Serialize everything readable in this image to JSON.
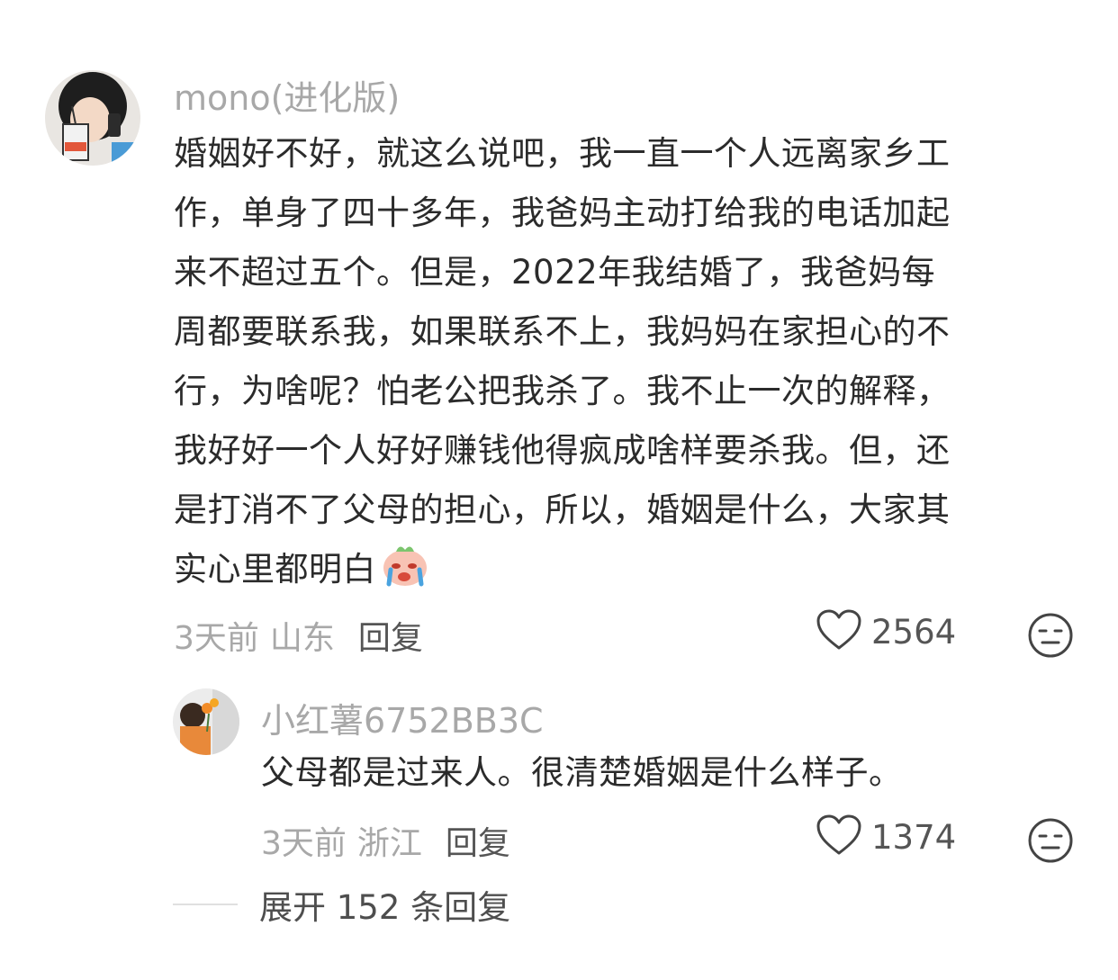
{
  "comments": [
    {
      "username": "mono(进化版)",
      "lines": [
        "婚姻好不好，就这么说吧，我一直一个人远离家乡工",
        "作，单身了四十多年，我爸妈主动打给我的电话加起",
        "来不超过五个。但是，2022年我结婚了，我爸妈每",
        "周都要联系我，如果联系不上，我妈妈在家担心的不",
        "行，为啥呢？怕老公把我杀了。我不止一次的解释，",
        "我好好一个人好好赚钱他得疯成啥样要杀我。但，还",
        "是打消不了父母的担心，所以，婚姻是什么，大家其",
        "实心里都明白"
      ],
      "emoji": "crying-face-emoji",
      "time": "3天前",
      "location": "山东",
      "reply_label": "回复",
      "like_count": "2564"
    },
    {
      "username": "小红薯6752BB3C",
      "lines": [
        "父母都是过来人。很清楚婚姻是什么样子。"
      ],
      "time": "3天前",
      "location": "浙江",
      "reply_label": "回复",
      "like_count": "1374"
    }
  ],
  "expand_label": "展开 152 条回复",
  "colors": {
    "text": "#2b2b2b",
    "muted": "#a8a8a8",
    "secondary": "#555555",
    "divider": "#e0e0e0"
  }
}
